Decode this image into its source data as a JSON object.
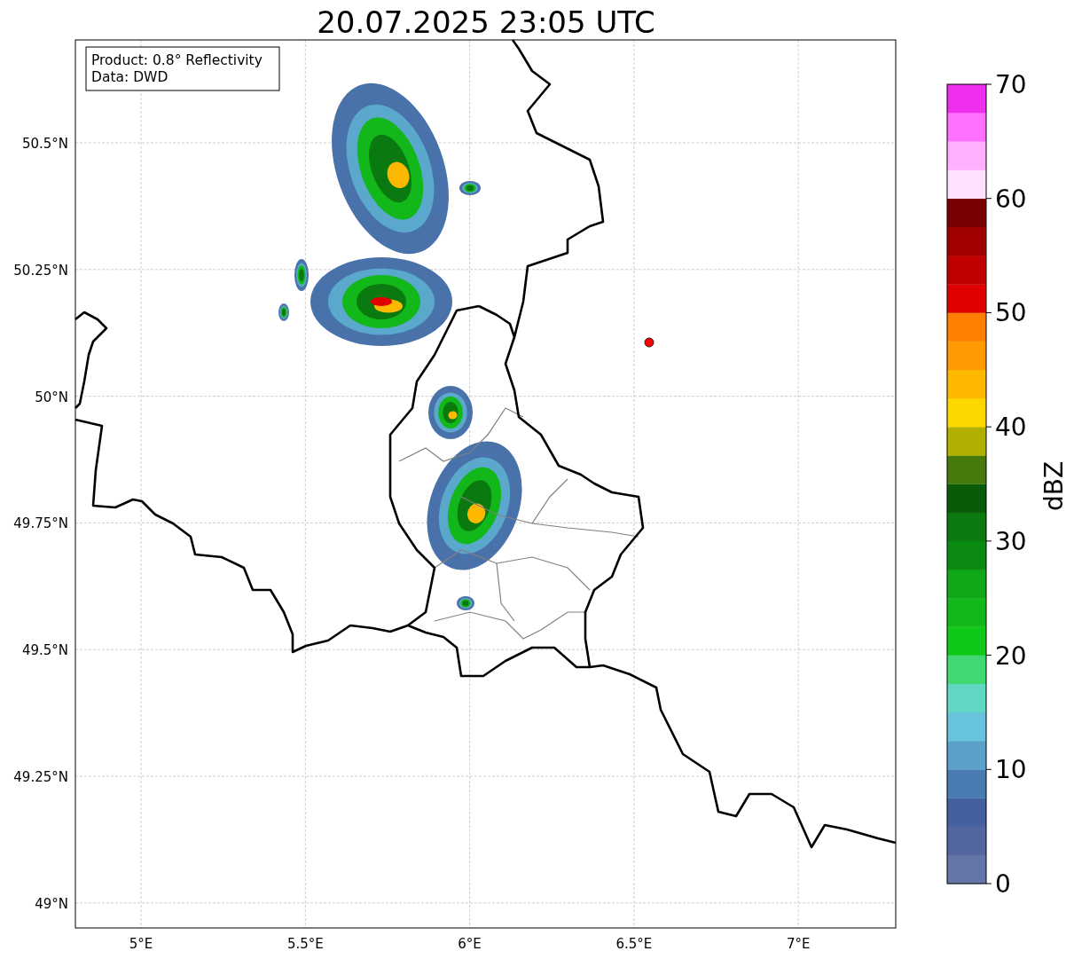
{
  "title": "20.07.2025 23:05 UTC",
  "info_box": [
    "Product: 0.8° Reflectivity",
    "Data: DWD"
  ],
  "y_ticks": [
    "50.5°N",
    "50.25°N",
    "50°N",
    "49.75°N",
    "49.5°N",
    "49.25°N",
    "49°N"
  ],
  "x_ticks": [
    "5°E",
    "5.5°E",
    "6°E",
    "6.5°E",
    "7°E"
  ],
  "colorbar": {
    "label": "dBZ",
    "ticks": [
      "70",
      "60",
      "50",
      "40",
      "30",
      "20",
      "10",
      "0"
    ],
    "bands": [
      {
        "color": "#6475a8"
      },
      {
        "color": "#5466a0"
      },
      {
        "color": "#4460a0"
      },
      {
        "color": "#4a7ab2"
      },
      {
        "color": "#5aa0c8"
      },
      {
        "color": "#68c4dc"
      },
      {
        "color": "#60d8c4"
      },
      {
        "color": "#40d870"
      },
      {
        "color": "#10c818"
      },
      {
        "color": "#10b818"
      },
      {
        "color": "#10a818"
      },
      {
        "color": "#0a8a10"
      },
      {
        "color": "#0a7a10"
      },
      {
        "color": "#0a5a0a"
      },
      {
        "color": "#467a0a"
      },
      {
        "color": "#b0b000"
      },
      {
        "color": "#ffd700"
      },
      {
        "color": "#ffb800"
      },
      {
        "color": "#ff9a00"
      },
      {
        "color": "#ff8000"
      },
      {
        "color": "#e00000"
      },
      {
        "color": "#c00000"
      },
      {
        "color": "#a00000"
      },
      {
        "color": "#780000"
      },
      {
        "color": "#ffe0ff"
      },
      {
        "color": "#ffb0ff"
      },
      {
        "color": "#ff70ff"
      },
      {
        "color": "#ee30ee"
      }
    ]
  }
}
